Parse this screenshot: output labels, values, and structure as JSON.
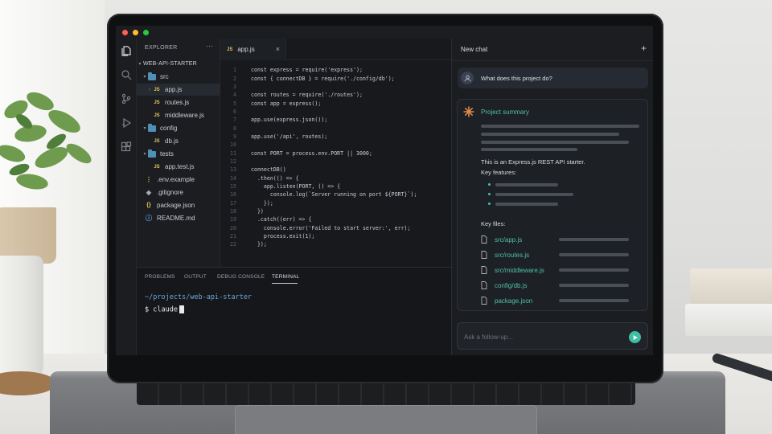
{
  "window": {
    "title_bar_buttons": [
      "close",
      "minimize",
      "maximize"
    ],
    "colors": {
      "close": "#ff5f57",
      "minimize": "#febc2e",
      "maximize": "#28c840"
    }
  },
  "activity_bar": {
    "icons": [
      "files-icon",
      "search-icon",
      "source-control-icon",
      "run-debug-icon",
      "extensions-icon"
    ]
  },
  "explorer": {
    "header": "EXPLORER",
    "more": "···",
    "root": "WEB-API-STARTER",
    "items": [
      {
        "label": "src",
        "kind": "folder",
        "depth": 1
      },
      {
        "label": "app.js",
        "kind": "js",
        "depth": 2,
        "active": true
      },
      {
        "label": "routes.js",
        "kind": "js",
        "depth": 2
      },
      {
        "label": "middleware.js",
        "kind": "js",
        "depth": 2
      },
      {
        "label": "config",
        "kind": "folder",
        "depth": 1
      },
      {
        "label": "db.js",
        "kind": "js",
        "depth": 2
      },
      {
        "label": "tests",
        "kind": "folder",
        "depth": 1
      },
      {
        "label": "app.test.js",
        "kind": "js",
        "depth": 2
      },
      {
        "label": ".env.example",
        "kind": "env",
        "depth": 1
      },
      {
        "label": ".gitignore",
        "kind": "git",
        "depth": 1
      },
      {
        "label": "package.json",
        "kind": "json",
        "depth": 1
      },
      {
        "label": "README.md",
        "kind": "md",
        "depth": 1
      }
    ]
  },
  "editor": {
    "tab": {
      "label": "app.js",
      "badge": "JS",
      "close": "×"
    },
    "lines": [
      "const express = require('express');",
      "const { connectDB } = require('./config/db');",
      "",
      "const routes = require('./routes');",
      "const app = express();",
      "",
      "app.use(express.json());",
      "",
      "app.use('/api', routes);",
      "",
      "const PORT = process.env.PORT || 3000;",
      "",
      "connectDB()",
      "  .then(() => {",
      "    app.listen(PORT, () => {",
      "      console.log(`Server running on port ${PORT}`);",
      "    });",
      "  })",
      "  .catch((err) => {",
      "    console.error('Failed to start server:', err);",
      "    process.exit(1);",
      "  });"
    ]
  },
  "panel": {
    "tabs": [
      "PROBLEMS",
      "OUTPUT",
      "DEBUG CONSOLE",
      "TERMINAL"
    ],
    "active_tab": "TERMINAL",
    "terminal": {
      "cwd": "~/projects/web-api-starter",
      "prompt": "$ claude"
    }
  },
  "chat": {
    "title": "New chat",
    "new_button": "+",
    "user_message": "What does this project do?",
    "summary": {
      "title": "Project summary",
      "intro": "This is an Express.js REST API starter.",
      "features_label": "Key features:",
      "files_label": "Key files:",
      "files": [
        "src/app.js",
        "src/routes.js",
        "src/middleware.js",
        "config/db.js",
        "package.json"
      ]
    },
    "input_placeholder": "Ask a follow-up...",
    "accent": "#4fc1a6"
  }
}
